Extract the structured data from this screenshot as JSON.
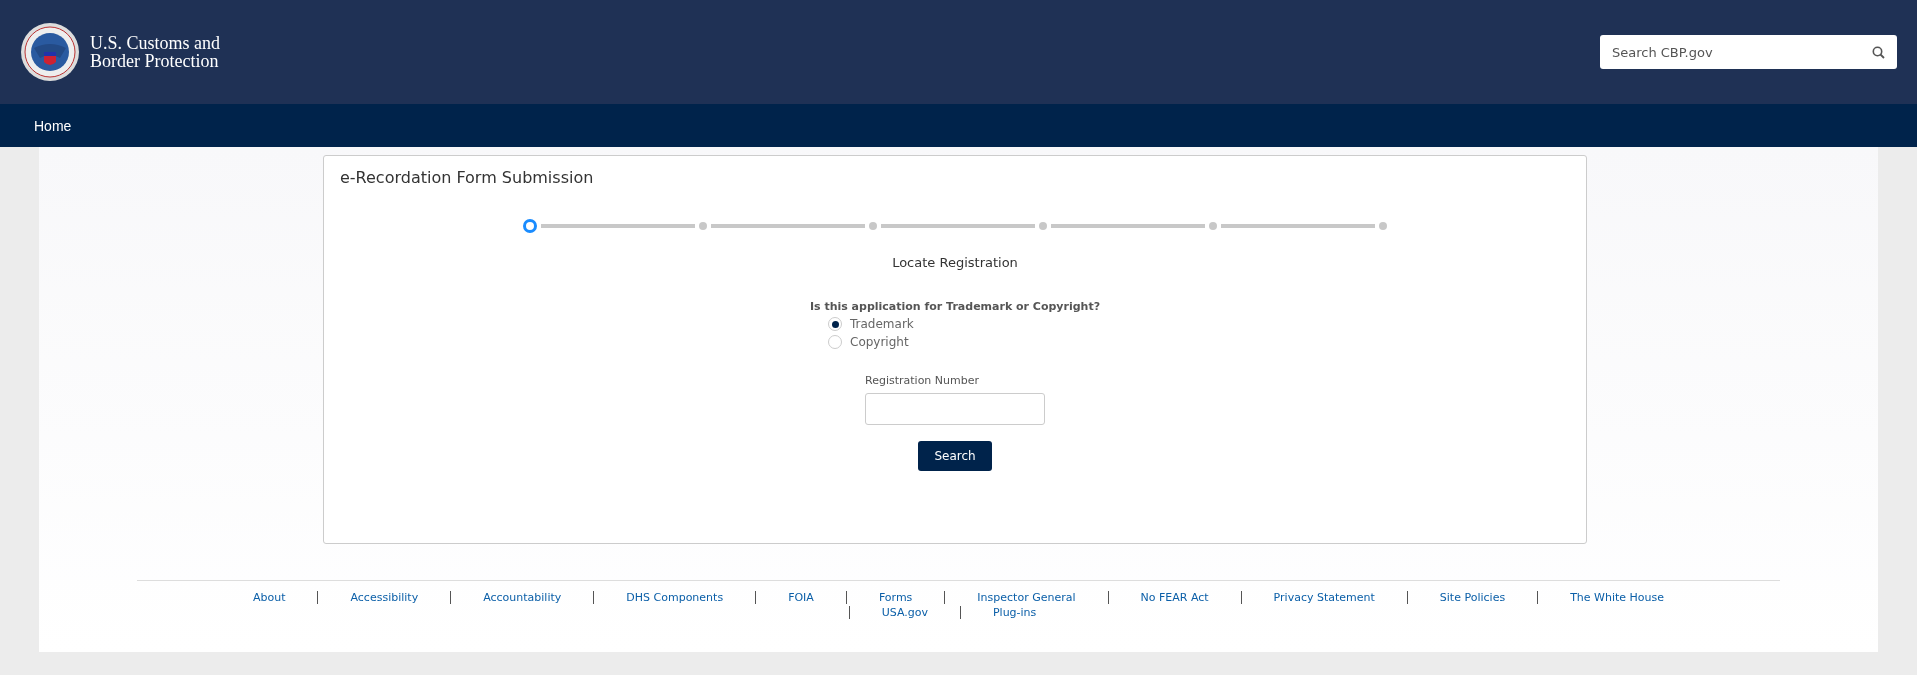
{
  "header": {
    "agency_name_line1": "U.S. Customs and",
    "agency_name_line2": "Border Protection",
    "search": {
      "placeholder": "Search CBP.gov"
    }
  },
  "nav": {
    "items": [
      {
        "label": "Home"
      }
    ]
  },
  "form": {
    "title": "e-Recordation Form Submission",
    "steps": [
      {
        "selected": true
      },
      {
        "selected": false
      },
      {
        "selected": false
      },
      {
        "selected": false
      },
      {
        "selected": false
      },
      {
        "selected": false
      }
    ],
    "step_title": "Locate Registration",
    "question": "Is this application for Trademark or Copyright?",
    "options": [
      {
        "label": "Trademark",
        "selected": true
      },
      {
        "label": "Copyright",
        "selected": false
      }
    ],
    "field_label": "Registration Number",
    "button": "Search"
  },
  "footer": {
    "links": [
      "About",
      "Accessibility",
      "Accountability",
      "DHS Components",
      "FOIA",
      "Forms",
      "Inspector General",
      "No FEAR Act",
      "Privacy Statement",
      "Site Policies",
      "The White House",
      "USA.gov",
      "Plug-ins"
    ]
  }
}
